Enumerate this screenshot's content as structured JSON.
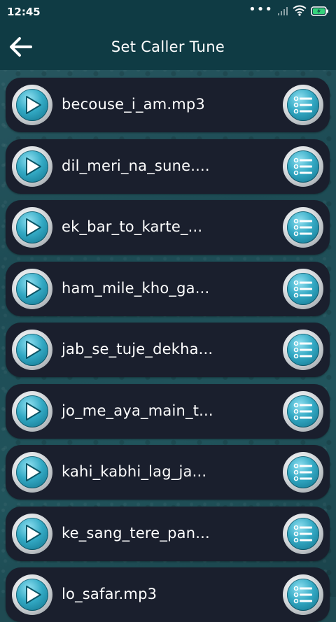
{
  "status_bar": {
    "time": "12:45",
    "icons": [
      "more-dots-icon",
      "signal-icon",
      "wifi-icon",
      "battery-charging-icon"
    ]
  },
  "app_bar": {
    "title": "Set Caller Tune",
    "back_icon": "arrow-left-icon"
  },
  "colors": {
    "app_bar": "#0f3b44",
    "card": "#1a1f2d",
    "accent": "#33a9c4",
    "text": "#ffffff"
  },
  "tracks": [
    {
      "title": "becouse_i_am.mp3"
    },
    {
      "title": "dil_meri_na_sune...."
    },
    {
      "title": "ek_bar_to_karte_..."
    },
    {
      "title": "ham_mile_kho_ga..."
    },
    {
      "title": "jab_se_tuje_dekha..."
    },
    {
      "title": "jo_me_aya_main_t..."
    },
    {
      "title": "kahi_kabhi_lag_ja..."
    },
    {
      "title": "ke_sang_tere_pan..."
    },
    {
      "title": "lo_safar.mp3"
    }
  ]
}
